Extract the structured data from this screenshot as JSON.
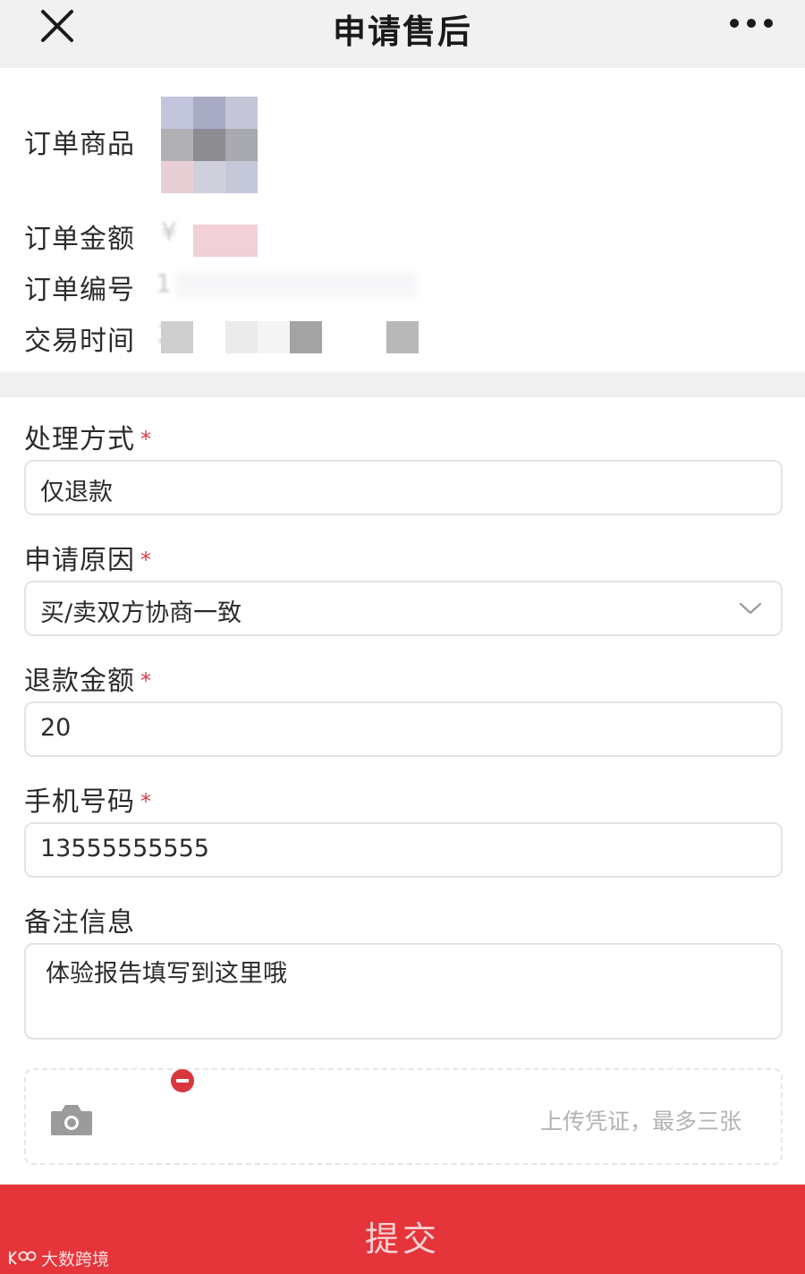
{
  "header": {
    "title": "申请售后",
    "close_icon": "close-icon",
    "more_icon": "more-dots-icon"
  },
  "order_info": {
    "product_label": "订单商品",
    "amount_label": "订单金额",
    "amount_value_visible": "¥",
    "order_no_label": "订单编号",
    "order_no_value_visible": "1",
    "time_label": "交易时间",
    "time_value_visible": "2"
  },
  "form": {
    "method": {
      "label": "处理方式",
      "required_mark": "*",
      "value": "仅退款"
    },
    "reason": {
      "label": "申请原因",
      "required_mark": "*",
      "value": "买/卖双方协商一致",
      "icon": "chevron-down-icon"
    },
    "refund_amount": {
      "label": "退款金额",
      "required_mark": "*",
      "value": "20"
    },
    "phone": {
      "label": "手机号码",
      "required_mark": "*",
      "value": "13555555555"
    },
    "remark": {
      "label": "备注信息",
      "value": "体验报告填写到这里哦"
    },
    "upload": {
      "hint": "上传凭证，最多三张",
      "icon": "camera-icon",
      "remove_icon": "remove-icon"
    }
  },
  "submit": {
    "label": "提交"
  },
  "watermark": {
    "text": "大数跨境"
  },
  "colors": {
    "primary_red": "#e5343a",
    "required_star": "#d9404a",
    "remove_badge": "#d9363e"
  }
}
